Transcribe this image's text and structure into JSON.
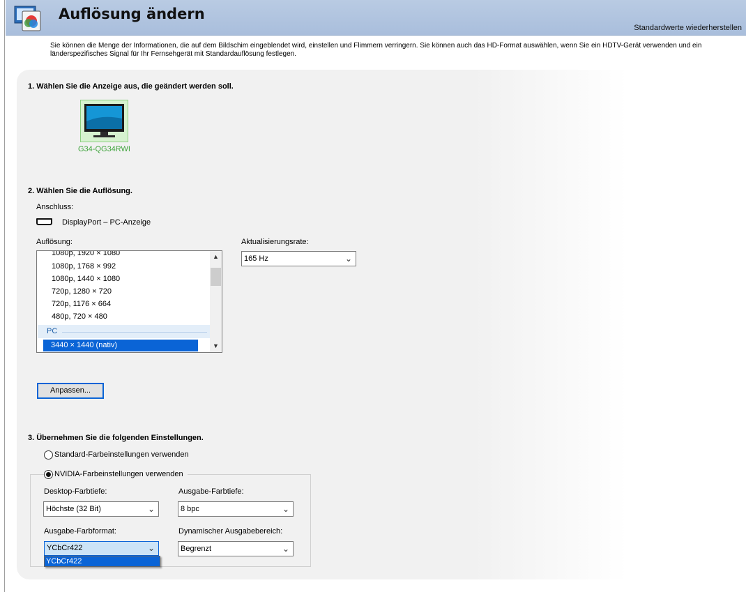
{
  "header": {
    "title": "Auflösung ändern",
    "restore_link": "Standardwerte wiederherstellen"
  },
  "description": "Sie können die Menge der Informationen, die auf dem Bildschim eingeblendet wird, einstellen und Flimmern verringern. Sie können auch das HD-Format auswählen, wenn Sie ein HDTV-Gerät verwenden und ein länderspezifisches Signal für Ihr Fernsehgerät mit Standardauflösung festlegen.",
  "section1": {
    "heading": "1. Wählen Sie die Anzeige aus, die geändert werden soll.",
    "display_name": "G34-QG34RWI"
  },
  "section2": {
    "heading": "2. Wählen Sie die Auflösung.",
    "connection_label": "Anschluss:",
    "connection_value": "DisplayPort – PC-Anzeige",
    "resolution_label": "Auflösung:",
    "resolution_items": [
      "1080p, 1920 × 1080",
      "1080p, 1768 × 992",
      "1080p, 1440 × 1080",
      "720p, 1280 × 720",
      "720p, 1176 × 664",
      "480p, 720 × 480"
    ],
    "resolution_group": "PC",
    "resolution_selected": "3440 × 1440 (nativ)",
    "refresh_label": "Aktualisierungsrate:",
    "refresh_value": "165 Hz",
    "customize_button": "Anpassen..."
  },
  "section3": {
    "heading": "3. Übernehmen Sie die folgenden Einstellungen.",
    "radio_default": "Standard-Farbeinstellungen verwenden",
    "radio_nvidia": "NVIDIA-Farbeinstellungen verwenden",
    "desktop_depth_label": "Desktop-Farbtiefe:",
    "desktop_depth_value": "Höchste (32 Bit)",
    "output_depth_label": "Ausgabe-Farbtiefe:",
    "output_depth_value": "8 bpc",
    "output_format_label": "Ausgabe-Farbformat:",
    "output_format_value": "YCbCr422",
    "output_format_option": "YCbCr422",
    "dynamic_range_label": "Dynamischer Ausgabebereich:",
    "dynamic_range_value": "Begrenzt"
  },
  "colors": {
    "header_bg": "#b1c5df",
    "selection": "#0a64d6",
    "display_tile": "#d6f2cf",
    "display_caption": "#3da33a"
  }
}
